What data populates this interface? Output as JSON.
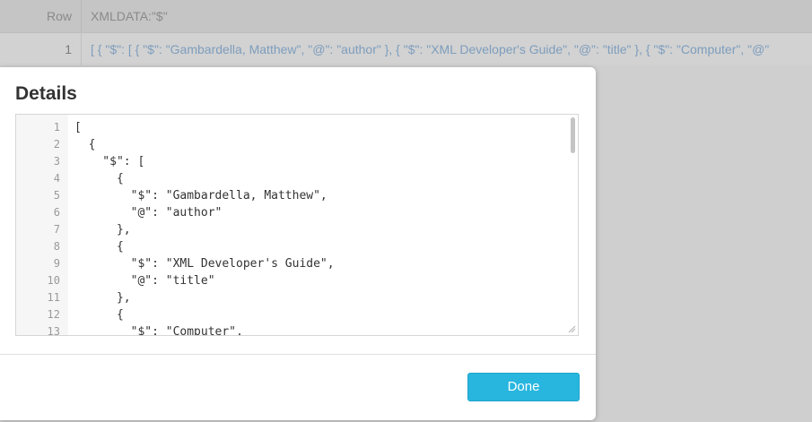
{
  "grid": {
    "row_header": "Row",
    "column_header": "XMLDATA:\"$\"",
    "rows": [
      {
        "number": "1",
        "value": "[ { \"$\": [ { \"$\": \"Gambardella, Matthew\", \"@\": \"author\" }, { \"$\": \"XML Developer's Guide\", \"@\": \"title\" }, { \"$\": \"Computer\", \"@\""
      }
    ]
  },
  "modal": {
    "title": "Details",
    "done_label": "Done",
    "lines": [
      {
        "num": "1",
        "text": "["
      },
      {
        "num": "2",
        "text": "  {"
      },
      {
        "num": "3",
        "text": "    \"$\": ["
      },
      {
        "num": "4",
        "text": "      {"
      },
      {
        "num": "5",
        "text": "        \"$\": \"Gambardella, Matthew\","
      },
      {
        "num": "6",
        "text": "        \"@\": \"author\""
      },
      {
        "num": "7",
        "text": "      },"
      },
      {
        "num": "8",
        "text": "      {"
      },
      {
        "num": "9",
        "text": "        \"$\": \"XML Developer's Guide\","
      },
      {
        "num": "10",
        "text": "        \"@\": \"title\""
      },
      {
        "num": "11",
        "text": "      },"
      },
      {
        "num": "12",
        "text": "      {"
      },
      {
        "num": "13",
        "text": "        \"$\": \"Computer\","
      }
    ]
  },
  "colors": {
    "accent": "#28b6de",
    "cell_value": "#7d9dbd"
  }
}
